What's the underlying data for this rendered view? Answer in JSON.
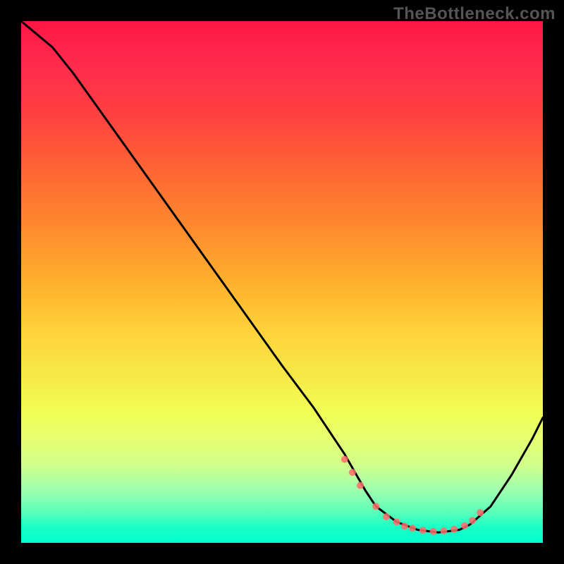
{
  "watermark": "TheBottleneck.com",
  "colors": {
    "background": "#000000",
    "curve": "#000000",
    "marker": "#ff6b6b",
    "gradient_top": "#ff1744",
    "gradient_bottom": "#00ffd0"
  },
  "chart_data": {
    "type": "line",
    "title": "",
    "xlabel": "",
    "ylabel": "",
    "xlim": [
      0,
      100
    ],
    "ylim": [
      0,
      100
    ],
    "series": [
      {
        "name": "curve",
        "x": [
          0,
          6,
          10,
          20,
          30,
          40,
          50,
          56,
          62,
          66,
          68,
          72,
          76,
          80,
          84,
          86,
          90,
          94,
          98,
          100
        ],
        "y": [
          100,
          95,
          90,
          76,
          62,
          48,
          34,
          26,
          17,
          10,
          7,
          4,
          2.5,
          2,
          2.5,
          3.5,
          7,
          13,
          20,
          24
        ]
      }
    ],
    "markers": {
      "name": "dots",
      "x": [
        62,
        63.5,
        65,
        68,
        70,
        72,
        73.5,
        75,
        77,
        79,
        81,
        83,
        85,
        86.5,
        88
      ],
      "y": [
        16,
        13.5,
        11,
        7,
        5,
        4,
        3.2,
        2.8,
        2.4,
        2.2,
        2.3,
        2.6,
        3.3,
        4.3,
        5.8
      ],
      "r": 5
    }
  }
}
